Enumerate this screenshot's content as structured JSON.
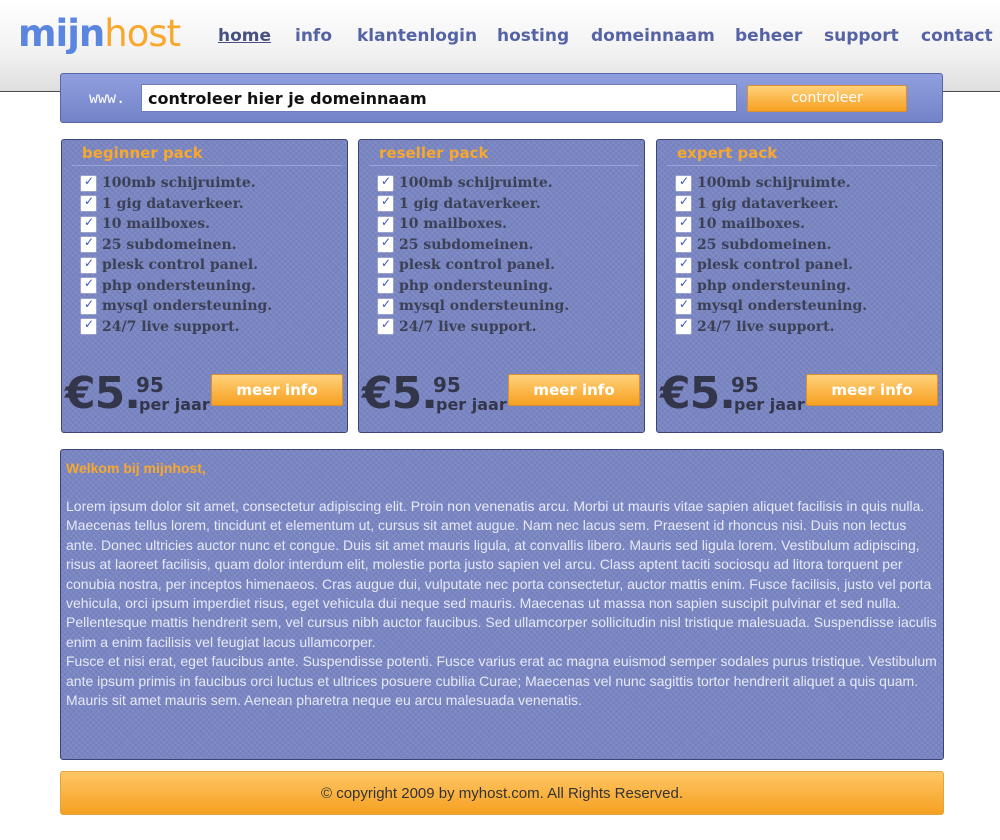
{
  "logo": {
    "part1": "mijn",
    "part2": "host"
  },
  "nav": [
    {
      "label": "home"
    },
    {
      "label": "info"
    },
    {
      "label": "klantenlogin"
    },
    {
      "label": "hosting"
    },
    {
      "label": "domeinnaam"
    },
    {
      "label": "beheer"
    },
    {
      "label": "support"
    },
    {
      "label": "contact"
    }
  ],
  "search": {
    "prefix": "www.",
    "value": "controleer hier je domeinnaam",
    "button": "controleer"
  },
  "packs": [
    {
      "title": "beginner pack",
      "features": [
        "100mb schijruimte.",
        "1 gig dataverkeer.",
        "10 mailboxes.",
        "25 subdomeinen.",
        "plesk control panel.",
        "php ondersteuning.",
        "mysql ondersteuning.",
        "24/7 live support."
      ],
      "price_main": "€5.",
      "price_cents": "95",
      "price_period": "per jaar",
      "button": "meer info"
    },
    {
      "title": "reseller pack",
      "features": [
        "100mb schijruimte.",
        "1 gig dataverkeer.",
        "10 mailboxes.",
        "25 subdomeinen.",
        "plesk control panel.",
        "php ondersteuning.",
        "mysql ondersteuning.",
        "24/7 live support."
      ],
      "price_main": "€5.",
      "price_cents": "95",
      "price_period": "per jaar",
      "button": "meer info"
    },
    {
      "title": "expert pack",
      "features": [
        "100mb schijruimte.",
        "1 gig dataverkeer.",
        "10 mailboxes.",
        "25 subdomeinen.",
        "plesk control panel.",
        "php ondersteuning.",
        "mysql ondersteuning.",
        "24/7 live support."
      ],
      "price_main": "€5.",
      "price_cents": "95",
      "price_period": "per jaar",
      "button": "meer info"
    }
  ],
  "welcome": {
    "title": "Welkom bij mijnhost,",
    "paragraph1": "Lorem ipsum dolor sit amet, consectetur adipiscing elit. Proin non venenatis arcu. Morbi ut mauris vitae sapien aliquet facilisis in quis nulla. Maecenas tellus lorem, tincidunt et elementum ut, cursus sit amet augue. Nam nec lacus sem. Praesent id rhoncus nisi. Duis non lectus ante. Donec ultricies auctor nunc et congue. Duis sit amet mauris ligula, at convallis libero. Mauris sed ligula lorem. Vestibulum adipiscing, risus at laoreet facilisis, quam dolor interdum elit, molestie porta justo sapien vel arcu. Class aptent taciti sociosqu ad litora torquent per conubia nostra, per inceptos himenaeos. Cras augue dui, vulputate nec porta consectetur, auctor mattis enim. Fusce facilisis, justo vel porta vehicula, orci ipsum imperdiet risus, eget vehicula dui neque sed mauris. Maecenas ut massa non sapien suscipit pulvinar et sed nulla. Pellentesque mattis hendrerit sem, vel cursus nibh auctor faucibus. Sed ullamcorper sollicitudin nisl tristique malesuada. Suspendisse iaculis enim a enim facilisis vel feugiat lacus ullamcorper.",
    "paragraph2": "Fusce et nisi erat, eget faucibus ante. Suspendisse potenti. Fusce varius erat ac magna euismod semper sodales purus tristique. Vestibulum ante ipsum primis in faucibus orci luctus et ultrices posuere cubilia Curae; Maecenas vel nunc sagittis tortor hendrerit aliquet a quis quam. Mauris sit amet mauris sem. Aenean pharetra neque eu arcu malesuada venenatis."
  },
  "footer": {
    "text": "© copyright 2009 by myhost.com. All Rights Reserved."
  }
}
